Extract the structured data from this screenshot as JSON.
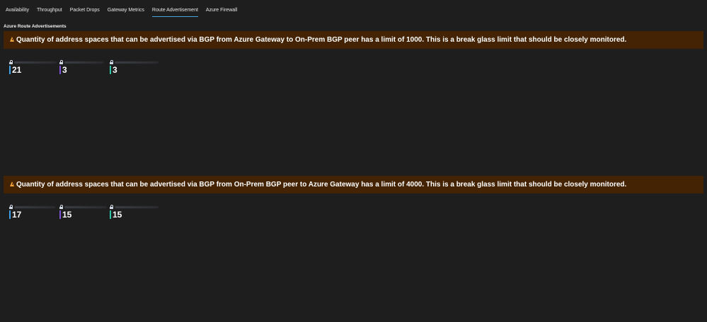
{
  "tabs": [
    {
      "label": "Availability",
      "active": false
    },
    {
      "label": "Throughput",
      "active": false
    },
    {
      "label": "Packet Drops",
      "active": false
    },
    {
      "label": "Gateway Metrics",
      "active": false
    },
    {
      "label": "Route Advertisement",
      "active": true
    },
    {
      "label": "Azure Firewall",
      "active": false
    }
  ],
  "section_title": "Azure Route Advertisements",
  "colors": {
    "background": "#1e1e1e",
    "banner_background": "#442304",
    "warning_icon": "#f2a33a",
    "active_tab_underline": "#4aa3df",
    "tile_bar_1": "#3ea0e6",
    "tile_bar_2": "#7b55d6",
    "tile_bar_3": "#2ec4a8"
  },
  "alerts": [
    {
      "icon": "warning-icon",
      "text": "Quantity of address spaces that can be advertised via BGP from Azure Gateway to On-Prem BGP peer has a limit of 1000. This is a break glass limit that should be closely monitored.",
      "tiles": [
        {
          "value": "21"
        },
        {
          "value": "3"
        },
        {
          "value": "3"
        }
      ]
    },
    {
      "icon": "warning-icon",
      "text": "Quantity of address spaces that can be advertised via BGP from On-Prem BGP peer to Azure Gateway has a limit of 4000. This is a break glass limit that should be closely monitored.",
      "tiles": [
        {
          "value": "17"
        },
        {
          "value": "15"
        },
        {
          "value": "15"
        }
      ]
    }
  ]
}
